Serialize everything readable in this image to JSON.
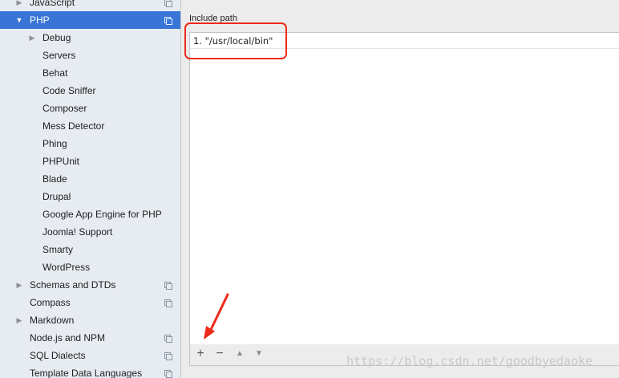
{
  "sidebar": {
    "items": [
      {
        "label": "JavaScript",
        "expander": "▶",
        "copy": true
      },
      {
        "label": "PHP",
        "expander": "▼",
        "copy": true,
        "selected": true
      },
      {
        "label": "Debug",
        "expander": "▶"
      },
      {
        "label": "Servers"
      },
      {
        "label": "Behat"
      },
      {
        "label": "Code Sniffer"
      },
      {
        "label": "Composer"
      },
      {
        "label": "Mess Detector"
      },
      {
        "label": "Phing"
      },
      {
        "label": "PHPUnit"
      },
      {
        "label": "Blade"
      },
      {
        "label": "Drupal"
      },
      {
        "label": "Google App Engine for PHP"
      },
      {
        "label": "Joomla! Support"
      },
      {
        "label": "Smarty"
      },
      {
        "label": "WordPress"
      },
      {
        "label": "Schemas and DTDs",
        "expander": "▶",
        "copy": true
      },
      {
        "label": "Compass",
        "copy": true
      },
      {
        "label": "Markdown",
        "expander": "▶"
      },
      {
        "label": "Node.js and NPM",
        "copy": true
      },
      {
        "label": "SQL Dialects",
        "copy": true
      },
      {
        "label": "Template Data Languages",
        "copy": true
      }
    ]
  },
  "main": {
    "include_path_label": "Include path",
    "paths": [
      {
        "index": "1.",
        "value": "\"/usr/local/bin\""
      }
    ],
    "toolbar": {
      "add": "+",
      "remove": "−",
      "up": "▲",
      "down": "▼"
    },
    "highlight_color": "#ee2a1a",
    "selection_color": "#3875d6"
  },
  "watermark": "https://blog.csdn.net/goodbyedaoke"
}
